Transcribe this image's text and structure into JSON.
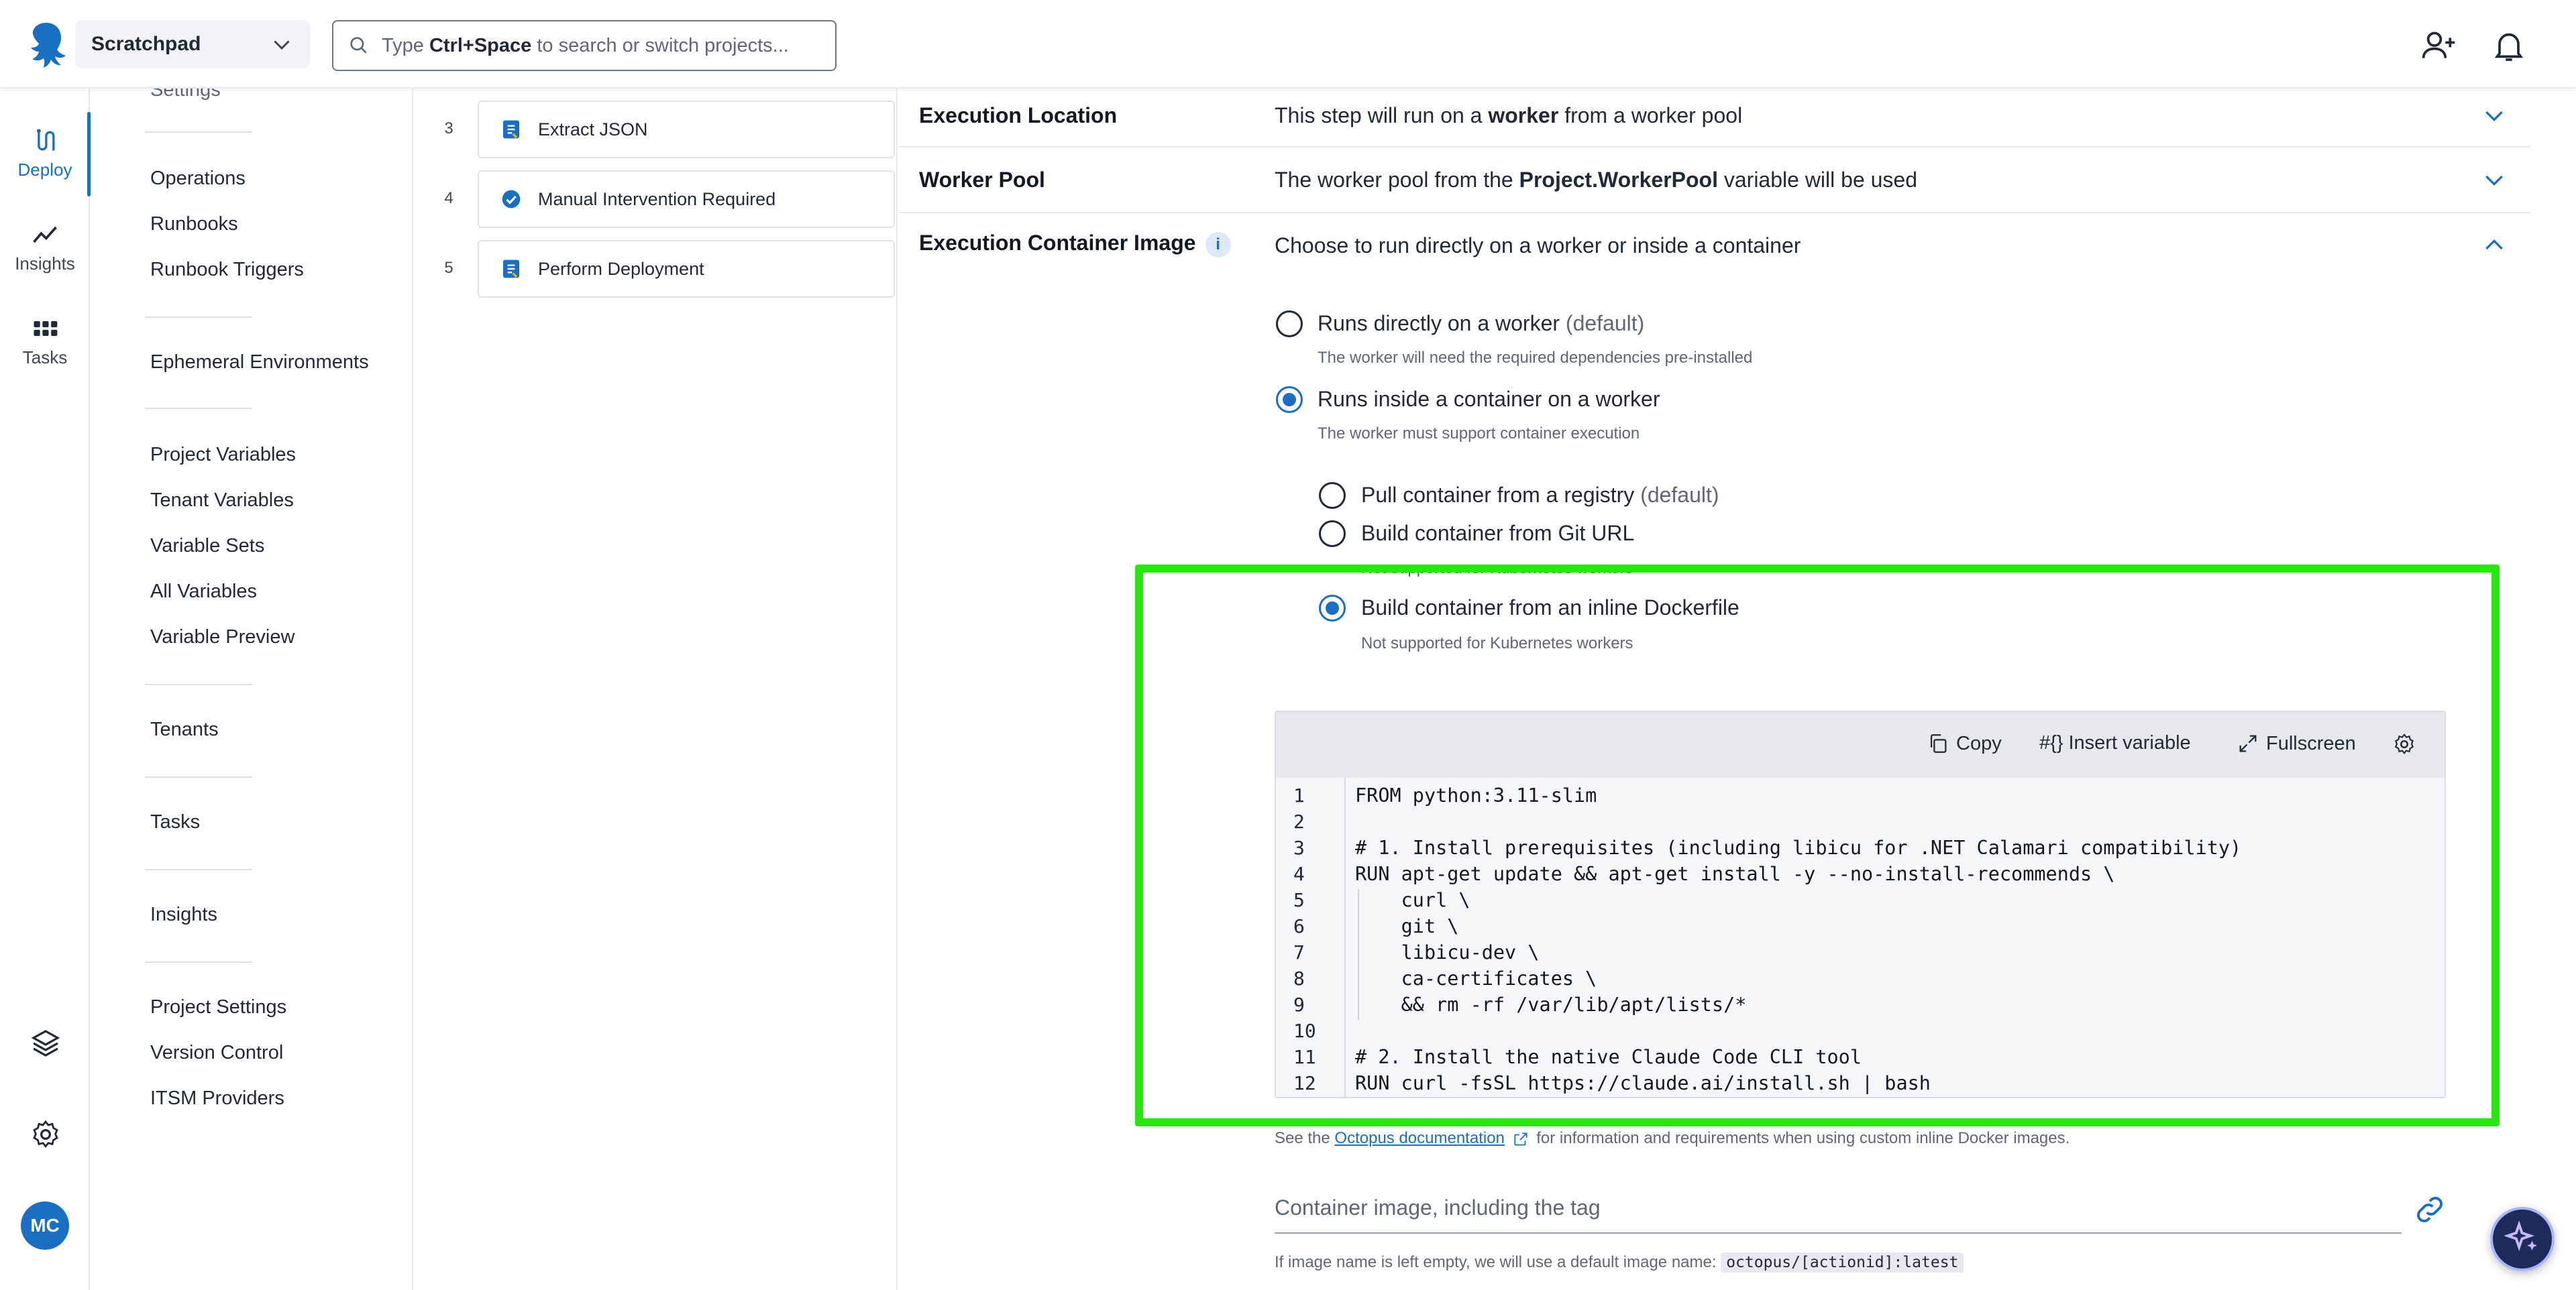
{
  "topbar": {
    "project_name": "Scratchpad",
    "search_prefix": "Type ",
    "search_shortcut": "Ctrl+Space",
    "search_suffix": " to search or switch projects..."
  },
  "rail": {
    "deploy": "Deploy",
    "insights": "Insights",
    "tasks": "Tasks",
    "avatar_initials": "MC"
  },
  "sidenav": {
    "cut_top": "Settings",
    "groups": [
      [
        "Operations",
        "Runbooks",
        "Runbook Triggers"
      ],
      [
        "Ephemeral Environments"
      ],
      [
        "Project Variables",
        "Tenant Variables",
        "Variable Sets",
        "All Variables",
        "Variable Preview"
      ],
      [
        "Tenants"
      ],
      [
        "Tasks"
      ],
      [
        "Insights"
      ],
      [
        "Project Settings",
        "Version Control",
        "ITSM Providers"
      ]
    ]
  },
  "steps": [
    {
      "num": "3",
      "label": "Extract JSON",
      "icon": "script-icon"
    },
    {
      "num": "4",
      "label": "Manual Intervention Required",
      "icon": "check-circle-icon"
    },
    {
      "num": "5",
      "label": "Perform Deployment",
      "icon": "script-icon"
    }
  ],
  "sections": {
    "execution_location": {
      "label": "Execution Location",
      "value_pre": "This step will run on a ",
      "value_bold": "worker",
      "value_post": " from a worker pool"
    },
    "worker_pool": {
      "label": "Worker Pool",
      "value_pre": "The worker pool from the ",
      "value_bold": "Project.WorkerPool",
      "value_post": " variable will be used"
    },
    "container_image": {
      "label": "Execution Container Image",
      "info": "i",
      "value": "Choose to run directly on a worker or inside a container"
    }
  },
  "run_options": [
    {
      "label": "Runs directly on a worker",
      "suffix": " (default)",
      "help": "The worker will need the required dependencies pre-installed",
      "selected": false
    },
    {
      "label": "Runs inside a container on a worker",
      "suffix": "",
      "help": "The worker must support container execution",
      "selected": true
    }
  ],
  "container_options": [
    {
      "label": "Pull container from a registry",
      "suffix": " (default)",
      "help": "",
      "selected": false
    },
    {
      "label": "Build container from Git URL",
      "suffix": "",
      "help": "Not supported for Kubernetes workers",
      "selected": false
    },
    {
      "label": "Build container from an inline Dockerfile",
      "suffix": "",
      "help": "Not supported for Kubernetes workers",
      "selected": true
    }
  ],
  "editor": {
    "copy": "Copy",
    "insert_variable": "Insert variable",
    "insert_variable_glyph": "#{}",
    "fullscreen": "Fullscreen",
    "lines": [
      "FROM python:3.11-slim",
      "",
      "# 1. Install prerequisites (including libicu for .NET Calamari compatibility)",
      "RUN apt-get update && apt-get install -y --no-install-recommends \\",
      "    curl \\",
      "    git \\",
      "    libicu-dev \\",
      "    ca-certificates \\",
      "    && rm -rf /var/lib/apt/lists/*",
      "",
      "# 2. Install the native Claude Code CLI tool",
      "RUN curl -fsSL https://claude.ai/install.sh | bash"
    ],
    "line_numbers": [
      "1",
      "2",
      "3",
      "4",
      "5",
      "6",
      "7",
      "8",
      "9",
      "10",
      "11",
      "12"
    ]
  },
  "docs_help": {
    "pre": "See the ",
    "link": "Octopus documentation",
    "post": " for information and requirements when using custom inline Docker images."
  },
  "container_input": {
    "placeholder": "Container image, including the tag"
  },
  "default_image_help": {
    "pre": "If image name is left empty, we will use a default image name: ",
    "code": "octopus/[actionid]:latest"
  },
  "colors": {
    "accent": "#1a6fc2",
    "highlight": "#28e60f",
    "ai_button": "#1e2a5a"
  }
}
